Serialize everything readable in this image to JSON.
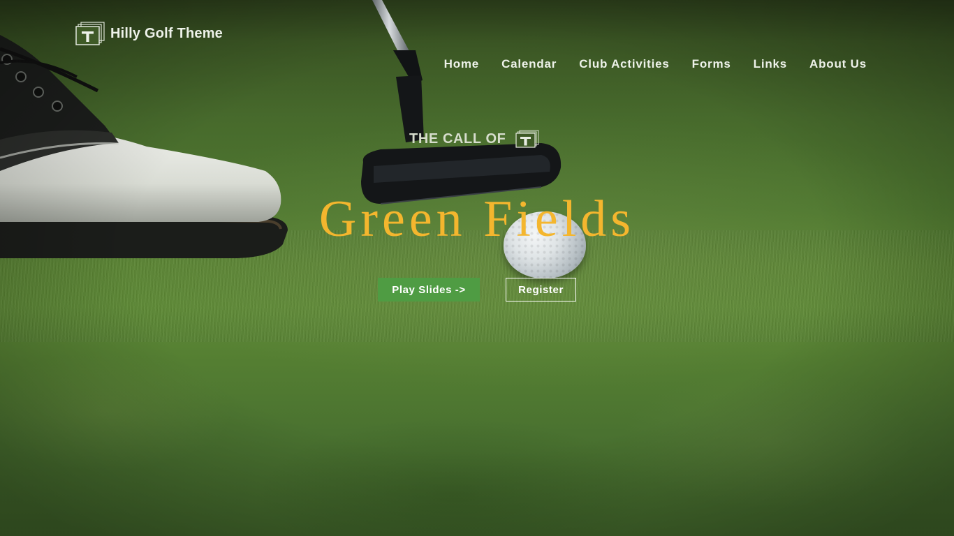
{
  "site": {
    "title": "Hilly Golf Theme",
    "logo_icon": "stacked-t-logo-icon"
  },
  "nav": {
    "items": [
      {
        "label": "Home"
      },
      {
        "label": "Calendar"
      },
      {
        "label": "Club Activities"
      },
      {
        "label": "Forms"
      },
      {
        "label": "Links"
      },
      {
        "label": "About Us"
      }
    ]
  },
  "hero": {
    "eyebrow": "THE CALL OF",
    "eyebrow_icon": "stacked-t-logo-icon",
    "title": "Green Fields",
    "primary_button": "Play Slides ->",
    "secondary_button": "Register"
  },
  "colors": {
    "accent_title": "#f4b62e",
    "primary_button_bg": "#4f9c43",
    "nav_text": "#eef2ea"
  }
}
